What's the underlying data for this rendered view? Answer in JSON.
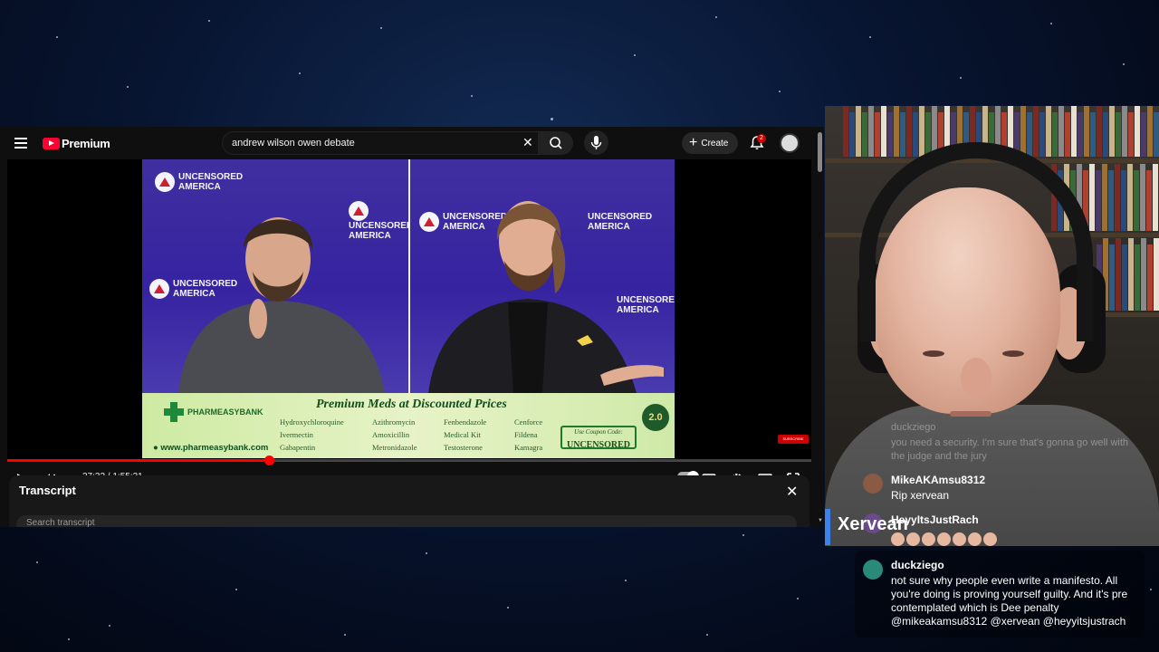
{
  "youtube": {
    "logo_text": "Premium",
    "search": {
      "value": "andrew wilson owen debate"
    },
    "create_label": "Create",
    "notification_count": "2",
    "colors": {
      "brand_red": "#ff0033",
      "progress_red": "#ff0000"
    }
  },
  "player": {
    "time_display": "37:32 / 1:55:31",
    "progress_fraction": 0.325,
    "overlay_brand_line1": "UNCENSORED",
    "overlay_brand_line2": "AMERICA",
    "ad": {
      "brand": "PHARMEASYBANK",
      "title": "Premium Meds at Discounted Prices",
      "meds_col1": [
        "Hydroxychloroquine",
        "Ivermectin",
        "Gabapentin"
      ],
      "meds_col2": [
        "Azithromycin",
        "Amoxicillin",
        "Metronidazole"
      ],
      "meds_col3": [
        "Fenbendazole",
        "Medical Kit",
        "Testosterone"
      ],
      "meds_col4": [
        "Cenforce",
        "Fildena",
        "Kamagra"
      ],
      "url": "www.pharmeasybank.com",
      "coupon_label": "Use Coupon Code:",
      "coupon_code": "UNCENSORED",
      "anniversary": "2.0"
    }
  },
  "transcript": {
    "title": "Transcript",
    "search_placeholder": "Search transcript"
  },
  "chat": {
    "ghost": {
      "user": "duckziego",
      "text": "you need a security. I'm sure that's gonna go well with the judge and the jury"
    },
    "messages": [
      {
        "user": "MikeAKAmsu8312",
        "text": "Rip xervean"
      },
      {
        "user": "HeyyItsJustRach",
        "text": ""
      }
    ],
    "overlay_name": "Xervean",
    "latest": {
      "user": "duckziego",
      "text": "not sure why people even write a manifesto. All you're doing is proving yourself guilty. And it's pre contemplated which is Dee penalty @mikeakamsu8312 @xervean @heyyitsjustrach"
    }
  }
}
